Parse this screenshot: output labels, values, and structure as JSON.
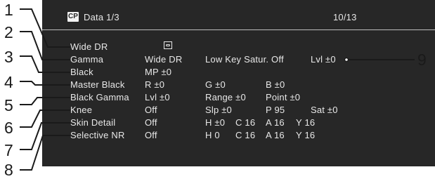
{
  "header": {
    "cp_icon": "CP",
    "title": "Data 1/3",
    "page": "10/13"
  },
  "rows": [
    {
      "label": "Wide DR"
    },
    {
      "label": "Gamma",
      "v1": "Wide DR",
      "v2": "Low Key Satur. Off",
      "v3": "Lvl ±0"
    },
    {
      "label": "Black",
      "v1": "MP ±0"
    },
    {
      "label": "Master Black",
      "v1": "R ±0",
      "v2": "G ±0",
      "v3": "B ±0"
    },
    {
      "label": "Black Gamma",
      "v1": "Lvl ±0",
      "v2": "Range ±0",
      "v3": "Point ±0"
    },
    {
      "label": "Knee",
      "v1": "Off",
      "v2": "Slp ±0",
      "v3": "P 95",
      "v4": "Sat ±0"
    },
    {
      "label": "Skin Detail",
      "v1": "Off",
      "v2": "H ±0",
      "v3": "C 16",
      "v4": "A 16",
      "v5": "Y 16"
    },
    {
      "label": "Selective NR",
      "v1": "Off",
      "v2": "H 0",
      "v3": "C 16",
      "v4": "A 16",
      "v5": "Y 16"
    }
  ],
  "icons": {
    "lock": "lock-icon"
  },
  "callouts": [
    "1",
    "2",
    "3",
    "4",
    "5",
    "6",
    "7",
    "8",
    "9"
  ]
}
